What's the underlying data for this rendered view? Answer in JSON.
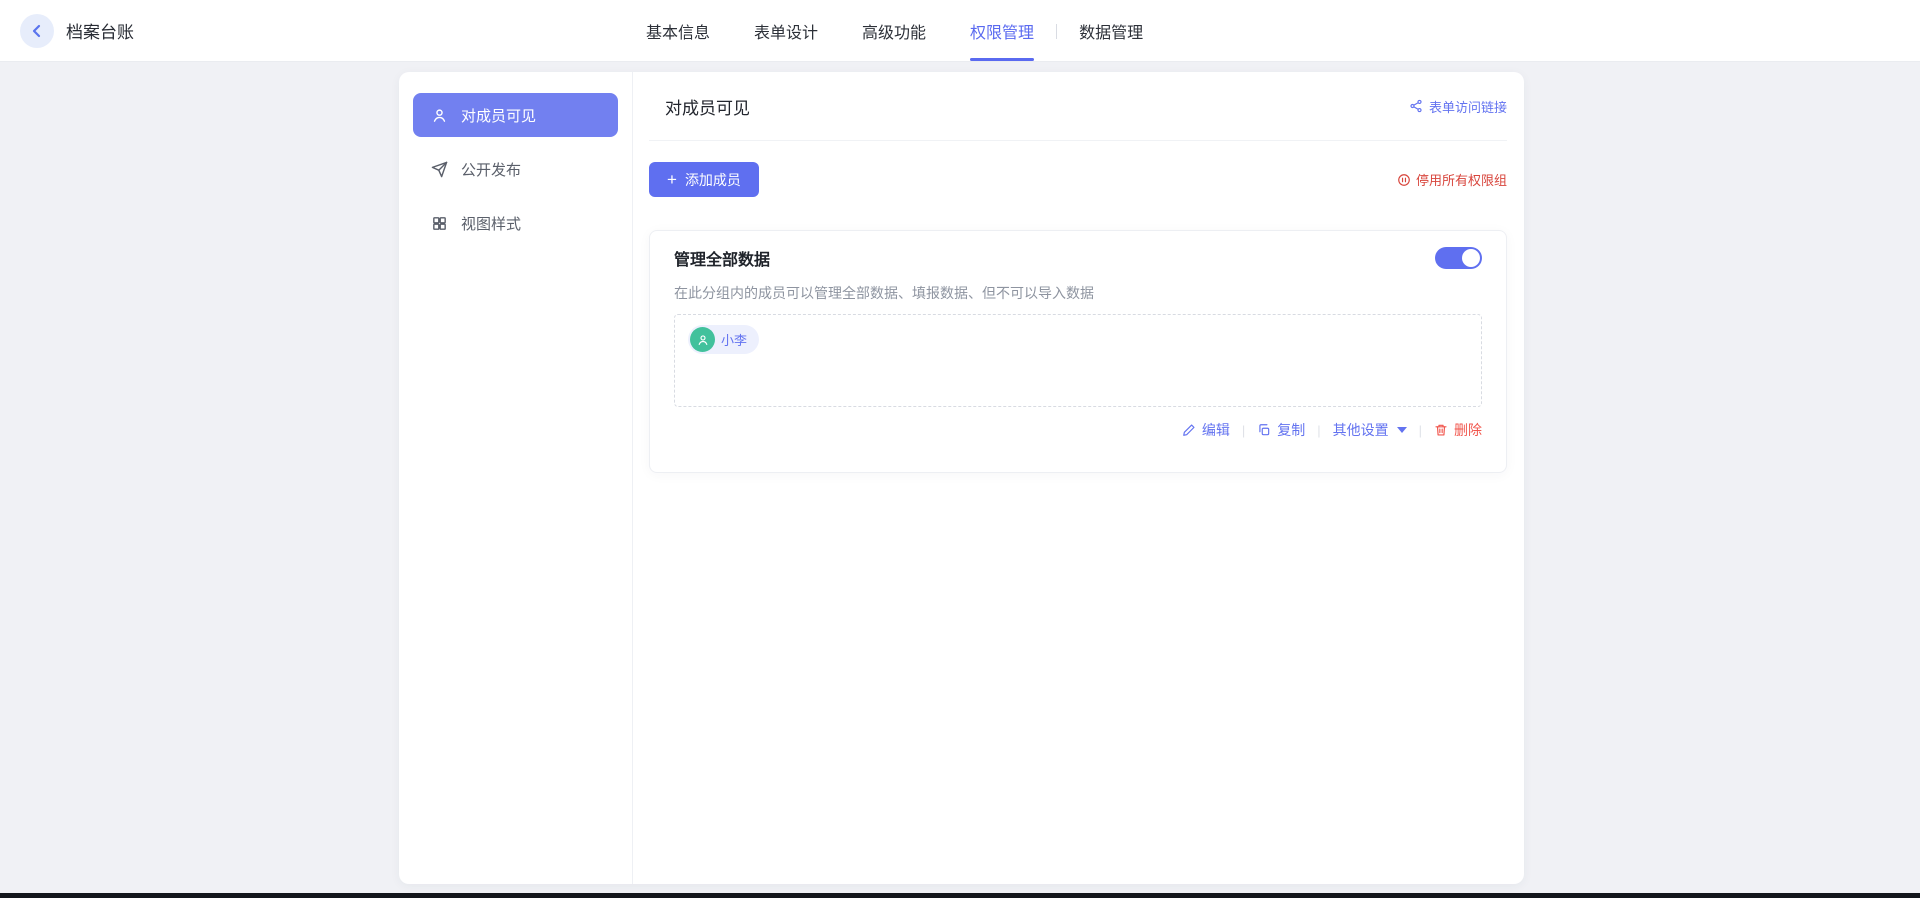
{
  "topbar": {
    "title": "档案台账",
    "tabs": [
      {
        "label": "基本信息",
        "active": false
      },
      {
        "label": "表单设计",
        "active": false
      },
      {
        "label": "高级功能",
        "active": false
      },
      {
        "label": "权限管理",
        "active": true
      },
      {
        "label": "数据管理",
        "active": false
      }
    ]
  },
  "sidebar": {
    "items": [
      {
        "label": "对成员可见",
        "icon": "user-icon",
        "active": true
      },
      {
        "label": "公开发布",
        "icon": "send-icon",
        "active": false
      },
      {
        "label": "视图样式",
        "icon": "grid-icon",
        "active": false
      }
    ]
  },
  "main": {
    "header": {
      "title": "对成员可见",
      "share_link_label": "表单访问链接",
      "share_link_icon": "share-nodes-icon"
    },
    "toolbar": {
      "add_member_label": "添加成员",
      "add_member_icon": "plus-icon",
      "disable_all_label": "停用所有权限组",
      "disable_all_icon": "pause-circle-icon"
    },
    "group_card": {
      "title": "管理全部数据",
      "enabled": true,
      "description": "在此分组内的成员可以管理全部数据、填报数据、但不可以导入数据",
      "members": [
        {
          "name": "小李",
          "avatar_icon": "user-icon"
        }
      ],
      "actions": {
        "edit_label": "编辑",
        "edit_icon": "pencil-icon",
        "copy_label": "复制",
        "copy_icon": "copy-icon",
        "more_label": "其他设置",
        "more_icon": "caret-down-icon",
        "delete_label": "删除",
        "delete_icon": "trash-icon"
      }
    }
  },
  "colors": {
    "primary": "#5f6ff0",
    "sidebar_active_bg": "#7280f0",
    "link_blue": "#6373f0",
    "danger_red": "#d8453c",
    "delete_red": "#f1564d",
    "avatar_green": "#41c19c",
    "chip_bg": "#edf0fd",
    "page_bg": "#f0f1f5",
    "toggle_on": "#5f6ff0"
  }
}
